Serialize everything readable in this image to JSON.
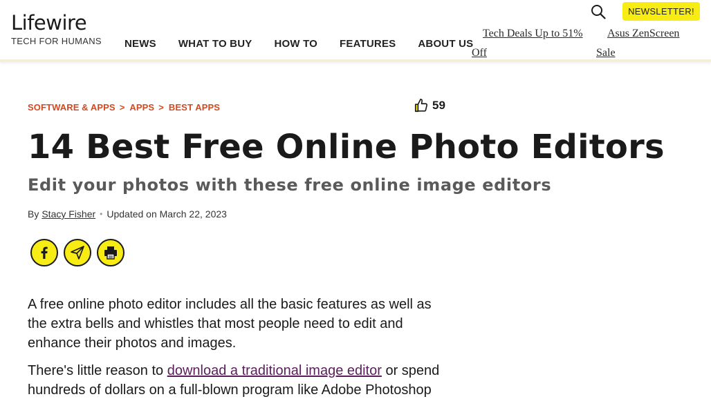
{
  "header": {
    "logo": "Lifewire",
    "tagline": "TECH FOR HUMANS",
    "nav": [
      "NEWS",
      "WHAT TO BUY",
      "HOW TO",
      "FEATURES",
      "ABOUT US"
    ],
    "newsletter_label": "NEWSLETTER!",
    "promo1": "Tech Deals Up to 51%",
    "promo1_cont": "Off",
    "promo2": "Asus ZenScreen",
    "promo2_cont": "Sale"
  },
  "article": {
    "breadcrumb": [
      "SOFTWARE & APPS",
      "APPS",
      "BEST APPS"
    ],
    "breadcrumb_sep": ">",
    "likes": "59",
    "title": "14 Best Free Online Photo Editors",
    "subtitle": "Edit your photos with these free online image editors",
    "by_label": "By",
    "author": "Stacy Fisher",
    "updated": "Updated on March 22, 2023",
    "p1": "A free online photo editor includes all the basic features as well as the extra bells and whistles that most people need to edit and enhance their photos and images.",
    "p2_before": "There's little reason to ",
    "p2_link": "download a traditional image editor",
    "p2_after": " or spend hundreds of dollars on a full-blown program like Adobe Photoshop"
  },
  "icons": {
    "search": "search-icon",
    "like": "thumbs-up-icon",
    "facebook": "facebook-icon",
    "email": "paper-plane-icon",
    "print": "printer-icon"
  },
  "colors": {
    "accent_yellow": "#f7ec13",
    "breadcrumb": "#d3491f",
    "link": "#5a1e5c"
  }
}
